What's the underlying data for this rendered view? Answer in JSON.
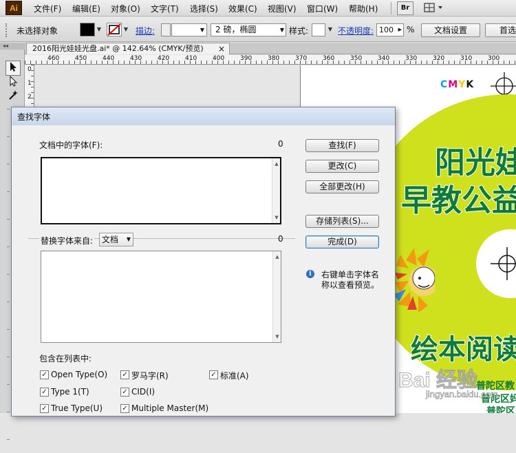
{
  "app": {
    "logo_text": "Ai"
  },
  "menu": {
    "items": [
      "文件(F)",
      "编辑(E)",
      "对象(O)",
      "文字(T)",
      "选择(S)",
      "效果(C)",
      "视图(V)",
      "窗口(W)",
      "帮助(H)"
    ],
    "bridge_label": "Br"
  },
  "control_bar": {
    "selection_label": "未选择对象",
    "stroke_label": "描边:",
    "brush_label": "2 磅，椭圆",
    "style_label": "样式:",
    "opacity_label": "不透明度:",
    "opacity_value": "100",
    "opacity_unit": "%",
    "doc_setup_button": "文档设置",
    "prefs_button": "首选"
  },
  "document": {
    "tab_title": "2016阳光娃娃光盘.ai* @ 142.64% (CMYK/预览)",
    "tab_close": "×"
  },
  "ruler": {
    "h_labels": [
      "460",
      "450",
      "440",
      "430",
      "420",
      "410",
      "400",
      "390",
      "380",
      "370",
      "360",
      "350",
      "340",
      "330",
      "320",
      "310",
      "300"
    ],
    "v_labels": [
      "0",
      "1",
      "2"
    ]
  },
  "artwork": {
    "cmyk": [
      "C",
      "M",
      "Y",
      "K"
    ],
    "title_line1": "阳光娃",
    "title_line2": "早教公益",
    "subtitle": "绘本阅读",
    "footer_lines": [
      "普陀区教",
      "普陀区妈",
      "普陀区"
    ],
    "watermark": "Bai 经验",
    "watermark_url": "jingyan.baidu.com"
  },
  "find_font_dialog": {
    "title": "查找字体",
    "doc_fonts_label": "文档中的字体(F):",
    "doc_fonts_count": "0",
    "replace_from_label": "替换字体来自:",
    "replace_from_value": "文档",
    "replace_count": "0",
    "buttons": {
      "find": "查找(F)",
      "change": "更改(C)",
      "change_all": "全部更改(H)",
      "save_list": "存储列表(S)...",
      "done": "完成(D)"
    },
    "hint": [
      "右键单击字体名",
      "称以查看预览。"
    ],
    "include_label": "包含在列表中:",
    "checkboxes": {
      "opentype": "Open Type(O)",
      "roman": "罗马字(R)",
      "standard": "标准(A)",
      "type1": "Type 1(T)",
      "cid": "CID(I)",
      "truetype": "True Type(U)",
      "multiple_master": "Multiple Master(M)"
    }
  },
  "colors": {
    "ai_logo_bg": "#4b2606",
    "ai_logo_fg": "#f8a229",
    "artwork_green": "#cfe01d",
    "artwork_title": "#0f7b3a",
    "link_blue": "#1a3fb8"
  }
}
